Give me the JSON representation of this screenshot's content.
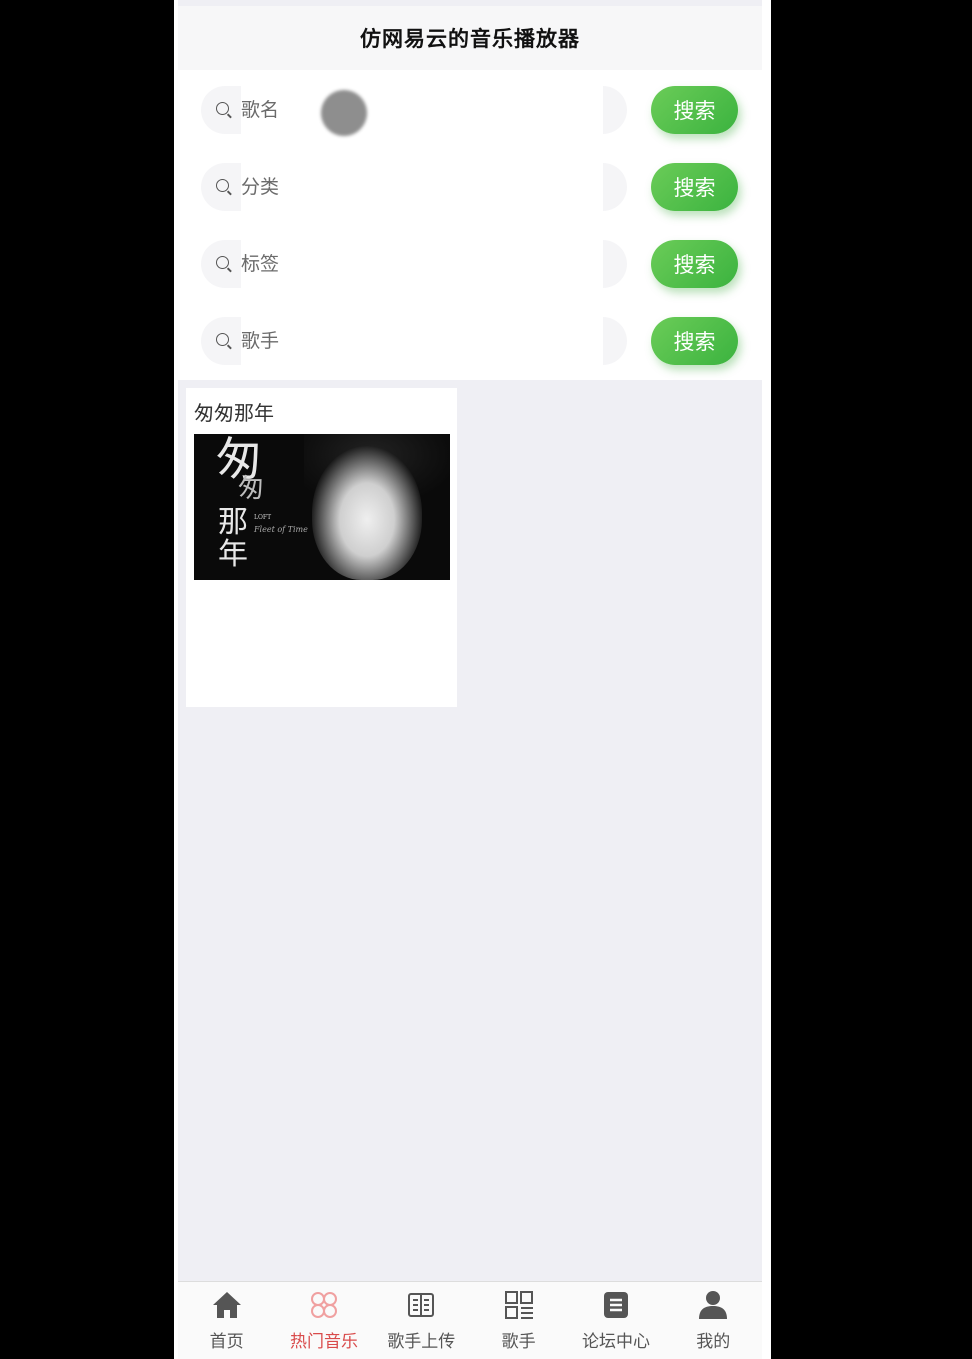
{
  "header": {
    "title": "仿网易云的音乐播放器"
  },
  "search": {
    "rows": [
      {
        "placeholder": "歌名",
        "button": "搜索"
      },
      {
        "placeholder": "分类",
        "button": "搜索"
      },
      {
        "placeholder": "标签",
        "button": "搜索"
      },
      {
        "placeholder": "歌手",
        "button": "搜索"
      }
    ]
  },
  "songs": [
    {
      "name": "匆匆那年",
      "cover": {
        "title_chars": [
          "匆",
          "匆",
          "那",
          "年"
        ],
        "small_text_1": "LOFT",
        "small_text_2": "Fleet of Time"
      }
    }
  ],
  "tabbar": {
    "items": [
      {
        "label": "首页",
        "icon": "home-icon",
        "active": false
      },
      {
        "label": "热门音乐",
        "icon": "hot-music-icon",
        "active": true
      },
      {
        "label": "歌手上传",
        "icon": "book-icon",
        "active": false
      },
      {
        "label": "歌手",
        "icon": "grid-list-icon",
        "active": false
      },
      {
        "label": "论坛中心",
        "icon": "document-icon",
        "active": false
      },
      {
        "label": "我的",
        "icon": "user-icon",
        "active": false
      }
    ],
    "active_color": "#d94b4b",
    "inactive_color": "#555555"
  },
  "colors": {
    "search_button": "#4cbb46",
    "background": "#efeff4"
  }
}
